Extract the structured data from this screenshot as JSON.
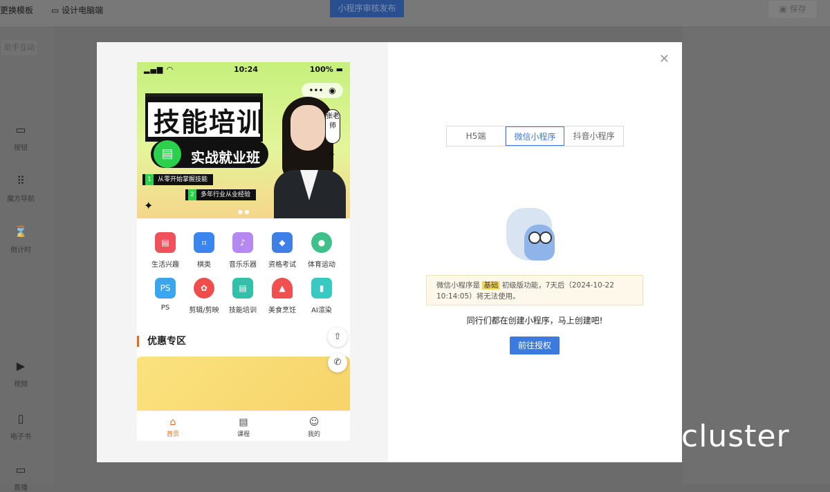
{
  "topbar": {
    "change_template": "更换模板",
    "design_pc": "设计电脑端",
    "publish_button": "小程序审核发布",
    "save_button": "保存"
  },
  "sidebar": {
    "chip": "助手互动",
    "items": [
      {
        "label": "按钮",
        "icon": "button-icon"
      },
      {
        "label": "魔方导航",
        "icon": "grid-nav-icon"
      },
      {
        "label": "倒计时",
        "icon": "hourglass-icon"
      },
      {
        "label": "视频",
        "icon": "video-icon"
      },
      {
        "label": "电子书",
        "icon": "ebook-icon"
      },
      {
        "label": "直播",
        "icon": "live-icon"
      }
    ]
  },
  "phone": {
    "status_time": "10:24",
    "status_battery": "100%",
    "banner": {
      "title": "技能培训",
      "subtitle": "实战就业班",
      "bullet1_num": "1",
      "bullet1": "从零开始掌握技能",
      "bullet2_num": "2",
      "bullet2": "多年行业从业经验",
      "tag": "张老师"
    },
    "grid": [
      {
        "label": "生活兴趣",
        "color": "#f0525c"
      },
      {
        "label": "棋类",
        "color": "#3a86ee"
      },
      {
        "label": "音乐乐器",
        "color": "#b689f0"
      },
      {
        "label": "资格考试",
        "color": "#3e7fe8"
      },
      {
        "label": "体育运动",
        "color": "#3fc08a"
      },
      {
        "label": "PS",
        "color": "#3ba6f0",
        "glyph": "PS"
      },
      {
        "label": "剪辑/剪映",
        "color": "#ef4c4c"
      },
      {
        "label": "技能培训",
        "color": "#32c0a8"
      },
      {
        "label": "美食烹饪",
        "color": "#f05050"
      },
      {
        "label": "AI渲染",
        "color": "#38c9c0"
      }
    ],
    "section_title": "优惠专区",
    "tabs": [
      {
        "label": "首页",
        "icon": "home-icon"
      },
      {
        "label": "课程",
        "icon": "course-icon"
      },
      {
        "label": "我的",
        "icon": "user-icon"
      }
    ]
  },
  "panel": {
    "tabs": [
      "H5端",
      "微信小程序",
      "抖音小程序"
    ],
    "active_tab": 1,
    "notice_pre": "微信小程序是",
    "notice_hl": "基础",
    "notice_post": "初级版功能，7天后（2024-10-22 10:14:05）将无法使用。",
    "cta_text": "同行们都在创建小程序，马上创建吧!",
    "cta_button": "前往授权"
  },
  "watermark": "cluster"
}
